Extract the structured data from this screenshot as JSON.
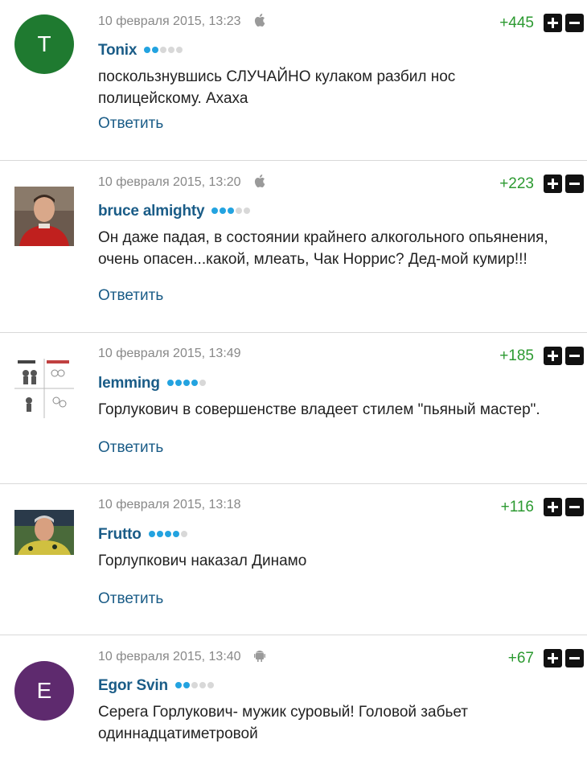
{
  "reply_label": "Ответить",
  "colors": {
    "accent": "#1a5c87",
    "score": "#2c9a31",
    "dot_on": "#23a3e0",
    "dot_off": "#d8d8d8"
  },
  "comments": [
    {
      "avatar_letter": "T",
      "avatar_color": "#1f7a30",
      "date": "10 февраля 2015, 13:23",
      "device": "apple-icon",
      "name": "Tonix",
      "rating_level": 2,
      "text": "поскользнувшись СЛУЧАЙНО кулаком разбил нос полицейскому. Ахаха",
      "score": "+445"
    },
    {
      "avatar_letter": "",
      "avatar_color": "#8b3a2a",
      "date": "10 февраля 2015, 13:20",
      "device": "apple-icon",
      "name": "bruce almighty",
      "rating_level": 3,
      "text": "Он даже падая, в состоянии крайнего алкогольного опьянения, очень опасен...какой, млеать, Чак Норрис? Дед-мой кумир!!!",
      "score": "+223"
    },
    {
      "avatar_letter": "",
      "avatar_color": "#ffffff",
      "date": "10 февраля 2015, 13:49",
      "device": "",
      "name": "lemming",
      "rating_level": 4,
      "text": "Горлукович в совершенстве владеет стилем \"пьяный мастер\".",
      "score": "+185"
    },
    {
      "avatar_letter": "",
      "avatar_color": "#4a6a3a",
      "date": "10 февраля 2015, 13:18",
      "device": "",
      "name": "Frutto",
      "rating_level": 4,
      "text": "Горлупкович наказал Динамо",
      "score": "+116"
    },
    {
      "avatar_letter": "E",
      "avatar_color": "#5e2a6e",
      "date": "10 февраля 2015, 13:40",
      "device": "android-icon",
      "name": "Egor Svin",
      "rating_level": 2,
      "text": "Серега Горлукович- мужик суровый! Головой забьет одиннадцатиметровой",
      "score": "+67"
    }
  ]
}
